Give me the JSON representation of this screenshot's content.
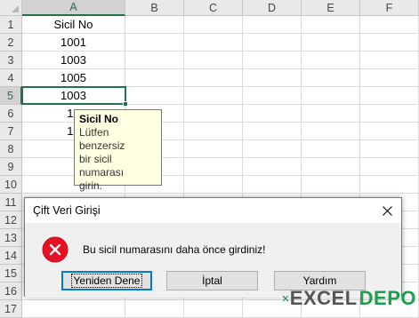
{
  "sheet": {
    "columns": [
      "A",
      "B",
      "C",
      "D",
      "E",
      "F"
    ],
    "rows": [
      "1",
      "2",
      "3",
      "4",
      "5",
      "6",
      "7",
      "8",
      "9",
      "10",
      "11",
      "12",
      "13",
      "14",
      "15",
      "16",
      "17"
    ],
    "column_a": [
      "Sicil No",
      "1001",
      "1003",
      "1005",
      "1003",
      "10",
      "10"
    ],
    "active_cell": "A5"
  },
  "tooltip": {
    "title": "Sicil No",
    "lines": [
      "Lütfen benzersiz",
      "bir sicil numarası",
      "girin."
    ]
  },
  "dialog": {
    "title": "Çift Veri Girişi",
    "message": "Bu sicil numarasını daha önce girdiniz!",
    "buttons": {
      "retry": "Yeniden Dene",
      "cancel": "İptal",
      "help": "Yardım"
    },
    "close_icon": "close-icon",
    "error_icon": "error-icon",
    "error_color": "#e81123"
  },
  "watermark": {
    "excel": "EXCEL",
    "depo": "DEPO"
  }
}
